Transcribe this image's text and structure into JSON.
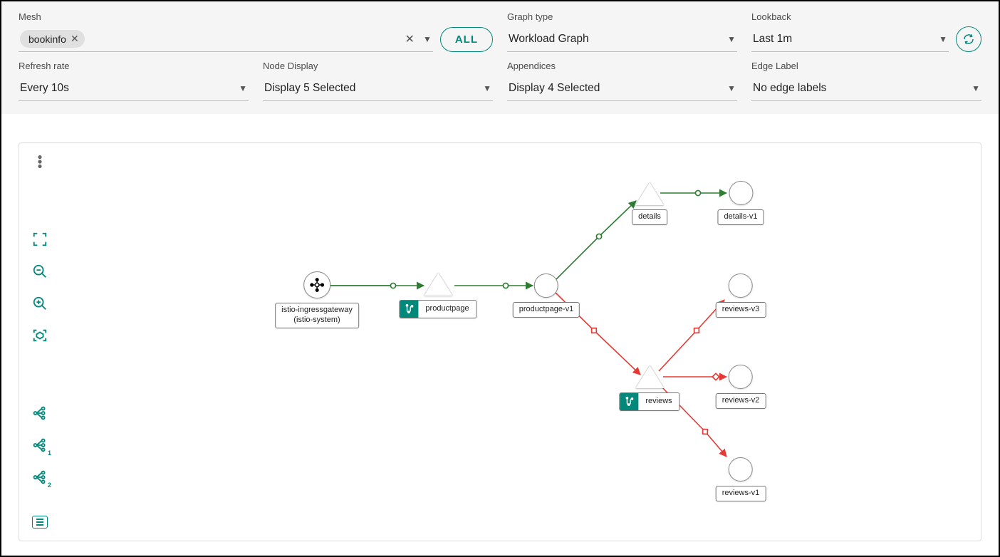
{
  "filters": {
    "mesh": {
      "label": "Mesh",
      "chip": "bookinfo",
      "all_btn": "ALL"
    },
    "graph_type": {
      "label": "Graph type",
      "value": "Workload Graph"
    },
    "lookback": {
      "label": "Lookback",
      "value": "Last 1m"
    },
    "refresh_rate": {
      "label": "Refresh rate",
      "value": "Every 10s"
    },
    "node_display": {
      "label": "Node Display",
      "value": "Display 5 Selected"
    },
    "appendices": {
      "label": "Appendices",
      "value": "Display 4 Selected"
    },
    "edge_label": {
      "label": "Edge Label",
      "value": "No edge labels"
    }
  },
  "graph": {
    "nodes": {
      "ingress": {
        "label_line1": "istio-ingressgateway",
        "label_line2": "(istio-system)"
      },
      "productpage_svc": {
        "label": "productpage"
      },
      "productpage_v1": {
        "label": "productpage-v1"
      },
      "details_svc": {
        "label": "details"
      },
      "details_v1": {
        "label": "details-v1"
      },
      "reviews_svc": {
        "label": "reviews"
      },
      "reviews_v1": {
        "label": "reviews-v1"
      },
      "reviews_v2": {
        "label": "reviews-v2"
      },
      "reviews_v3": {
        "label": "reviews-v3"
      }
    },
    "edges": [
      {
        "from": "ingress",
        "to": "productpage_svc",
        "status": "ok"
      },
      {
        "from": "productpage_svc",
        "to": "productpage_v1",
        "status": "ok"
      },
      {
        "from": "productpage_v1",
        "to": "details_svc",
        "status": "ok"
      },
      {
        "from": "details_svc",
        "to": "details_v1",
        "status": "ok"
      },
      {
        "from": "productpage_v1",
        "to": "reviews_svc",
        "status": "error"
      },
      {
        "from": "reviews_svc",
        "to": "reviews_v1",
        "status": "error"
      },
      {
        "from": "reviews_svc",
        "to": "reviews_v2",
        "status": "error"
      },
      {
        "from": "reviews_svc",
        "to": "reviews_v3",
        "status": "error"
      }
    ],
    "colors": {
      "ok": "#2e7d32",
      "error": "#e53935",
      "accent": "#00897b"
    }
  }
}
